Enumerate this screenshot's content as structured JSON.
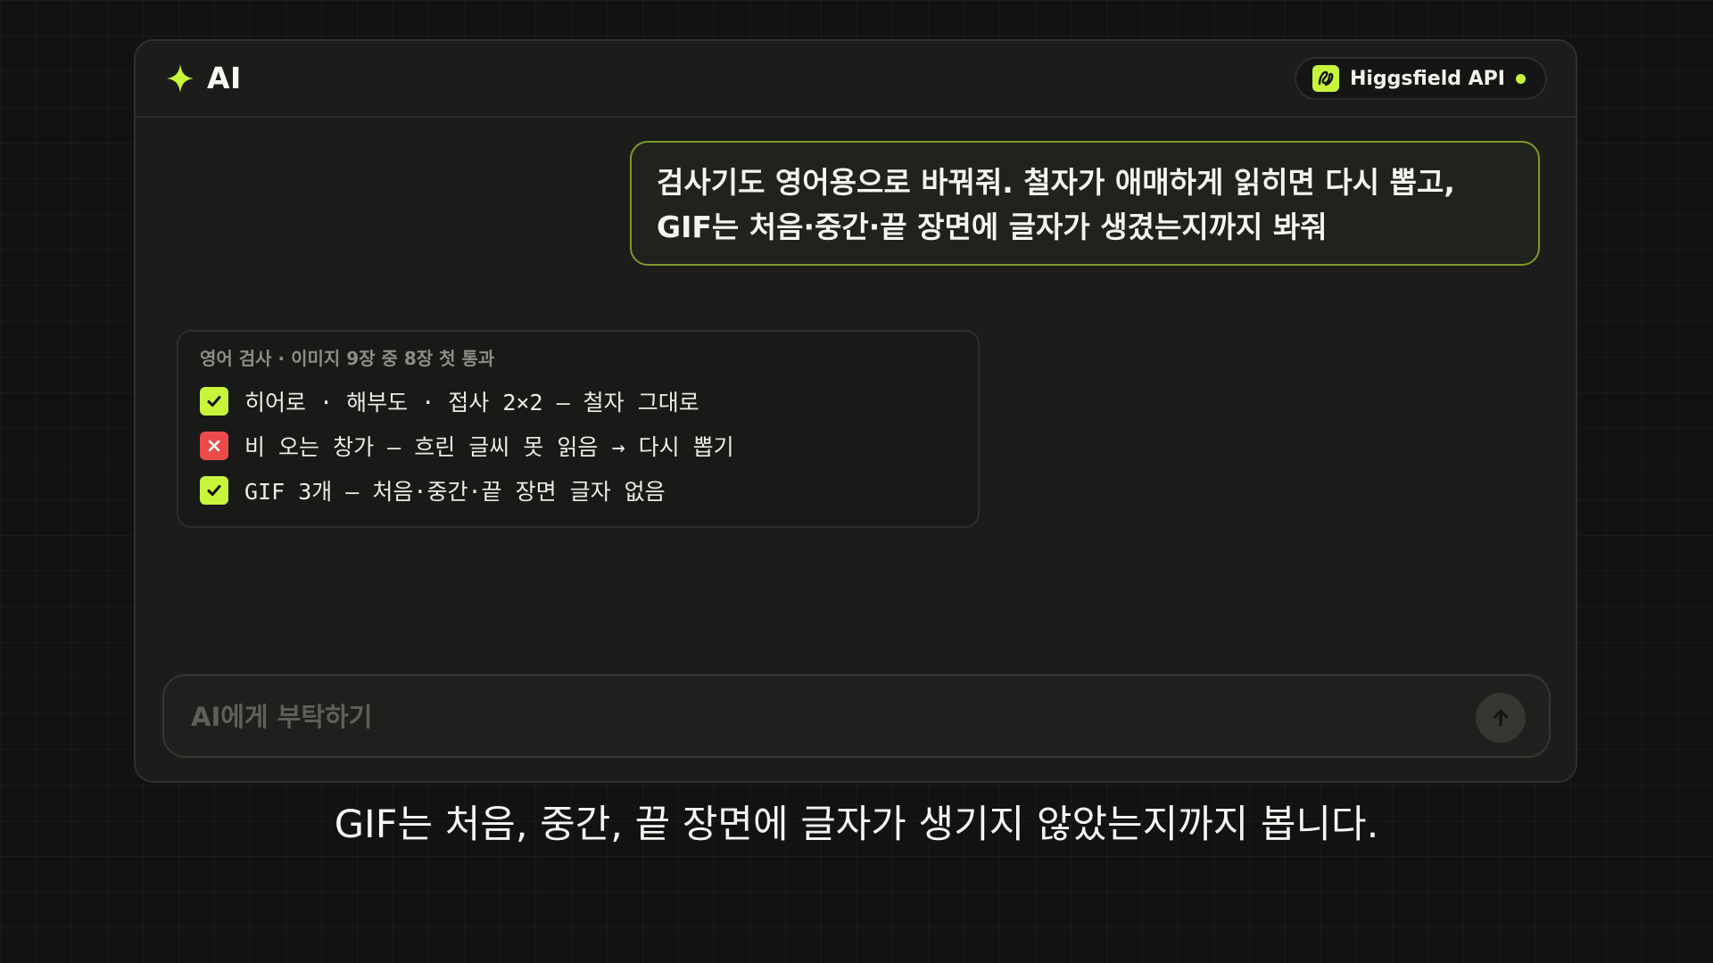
{
  "header": {
    "title": "AI",
    "api_label": "Higgsfield API",
    "status": "online"
  },
  "colors": {
    "accent": "#c6f53b",
    "fail": "#ec4b4b",
    "background": "#121212",
    "panel": "#1c1d1b"
  },
  "icons": {
    "brand": "sparkle-icon",
    "api": "higgsfield-logo-icon",
    "pass": "check-icon",
    "fail": "x-icon",
    "send": "arrow-up-icon"
  },
  "user_message": {
    "lines": [
      "검사기도 영어용으로 바꿔줘. 철자가 애매하게 읽히면 다시 뽑고,",
      "GIF는 처음·중간·끝 장면에 글자가 생겼는지까지 봐줘"
    ]
  },
  "result_card": {
    "title": "영어 검사 · 이미지 9장 중 8장 첫 통과",
    "items": [
      {
        "status": "pass",
        "text": "히어로 · 해부도 · 접사 2×2 — 철자 그대로"
      },
      {
        "status": "fail",
        "text": "비 오는 창가 — 흐린 글씨 못 읽음 → 다시 뽑기"
      },
      {
        "status": "pass",
        "text": "GIF 3개 — 처음·중간·끝 장면 글자 없음"
      }
    ]
  },
  "input": {
    "placeholder": "AI에게 부탁하기",
    "value": ""
  },
  "caption": "GIF는 처음, 중간, 끝 장면에 글자가 생기지 않았는지까지 봅니다."
}
